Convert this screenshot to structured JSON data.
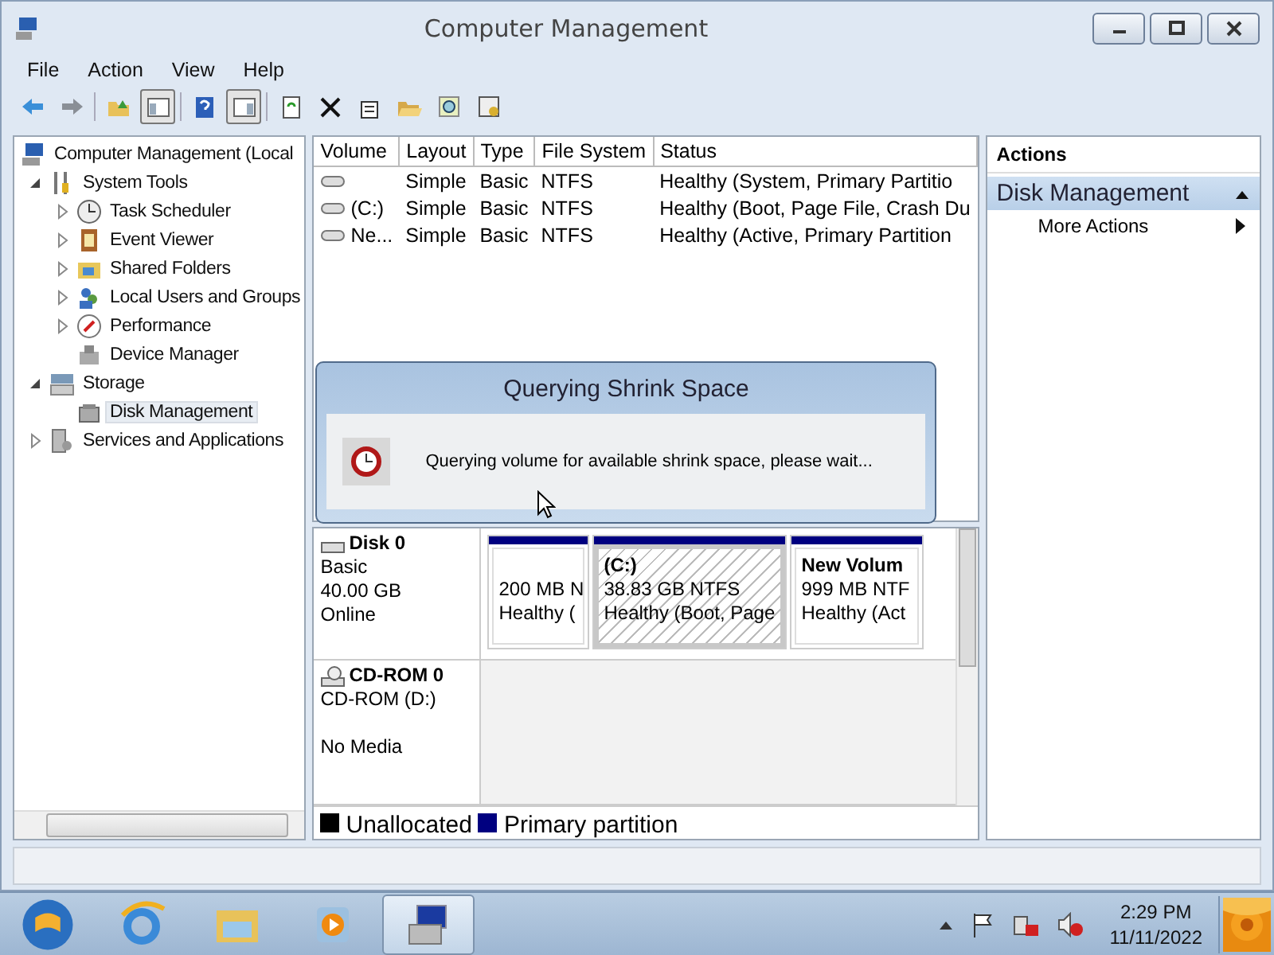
{
  "window": {
    "title": "Computer Management"
  },
  "menu": [
    "File",
    "Action",
    "View",
    "Help"
  ],
  "toolbar": [
    {
      "pressed": false
    },
    {
      "pressed": false
    },
    {
      "pressed": false
    },
    {
      "pressed": true
    },
    {
      "pressed": false
    },
    {
      "pressed": true
    },
    {
      "pressed": false
    },
    {
      "pressed": false
    },
    {
      "pressed": false
    },
    {
      "pressed": false
    },
    {
      "pressed": false
    },
    {
      "pressed": false
    }
  ],
  "tree": [
    {
      "label": "Computer Management (Local",
      "selected": false,
      "children": [
        {
          "label": "System Tools",
          "expanded": true,
          "selected": false,
          "children": [
            {
              "label": "Task Scheduler",
              "expanded": false,
              "selected": false
            },
            {
              "label": "Event Viewer",
              "expanded": false,
              "selected": false
            },
            {
              "label": "Shared Folders",
              "expanded": false,
              "selected": false
            },
            {
              "label": "Local Users and Groups",
              "expanded": false,
              "selected": false
            },
            {
              "label": "Performance",
              "expanded": false,
              "selected": false
            },
            {
              "label": "Device Manager",
              "selected": false
            }
          ]
        },
        {
          "label": "Storage",
          "expanded": true,
          "selected": false,
          "children": [
            {
              "label": "Disk Management",
              "selected": true
            }
          ]
        },
        {
          "label": "Services and Applications",
          "expanded": false,
          "selected": false
        }
      ]
    }
  ],
  "volumes": {
    "columns": [
      "Volume",
      "Layout",
      "Type",
      "File System",
      "Status"
    ],
    "rows": [
      [
        "",
        "Simple",
        "Basic",
        "NTFS",
        "Healthy (System, Primary Partitio"
      ],
      [
        "(C:)",
        "Simple",
        "Basic",
        "NTFS",
        "Healthy (Boot, Page File, Crash Du"
      ],
      [
        "Ne...",
        "Simple",
        "Basic",
        "NTFS",
        "Healthy (Active, Primary Partition"
      ]
    ]
  },
  "disks": [
    {
      "kind": "disk",
      "name": "Disk 0",
      "type": "Basic",
      "size": "40.00 GB",
      "status": "Online",
      "partitions": [
        {
          "size": "200 MB N",
          "status": "Healthy (",
          "selected": false
        },
        {
          "label": "(C:)",
          "size": "38.83 GB NTFS",
          "status": "Healthy (Boot, Page",
          "selected": true
        },
        {
          "label": "New Volum",
          "size": "999 MB NTF",
          "status": "Healthy (Act",
          "selected": false
        }
      ]
    },
    {
      "kind": "cdrom",
      "name": "CD-ROM 0",
      "type": "CD-ROM (D:)",
      "status": "No Media"
    }
  ],
  "legend": [
    {
      "label": "Unallocated",
      "color": "#000000"
    },
    {
      "label": "Primary partition",
      "color": "#000080"
    }
  ],
  "actions": {
    "title": "Actions",
    "section": "Disk Management",
    "items": [
      "More Actions"
    ]
  },
  "dialog": {
    "title": "Querying Shrink Space",
    "message": "Querying volume for available shrink space, please wait..."
  },
  "taskbar": {
    "apps": [
      {
        "selected": false
      },
      {
        "selected": false
      },
      {
        "selected": false
      },
      {
        "selected": true
      }
    ],
    "time": "2:29 PM",
    "date": "11/11/2022"
  }
}
